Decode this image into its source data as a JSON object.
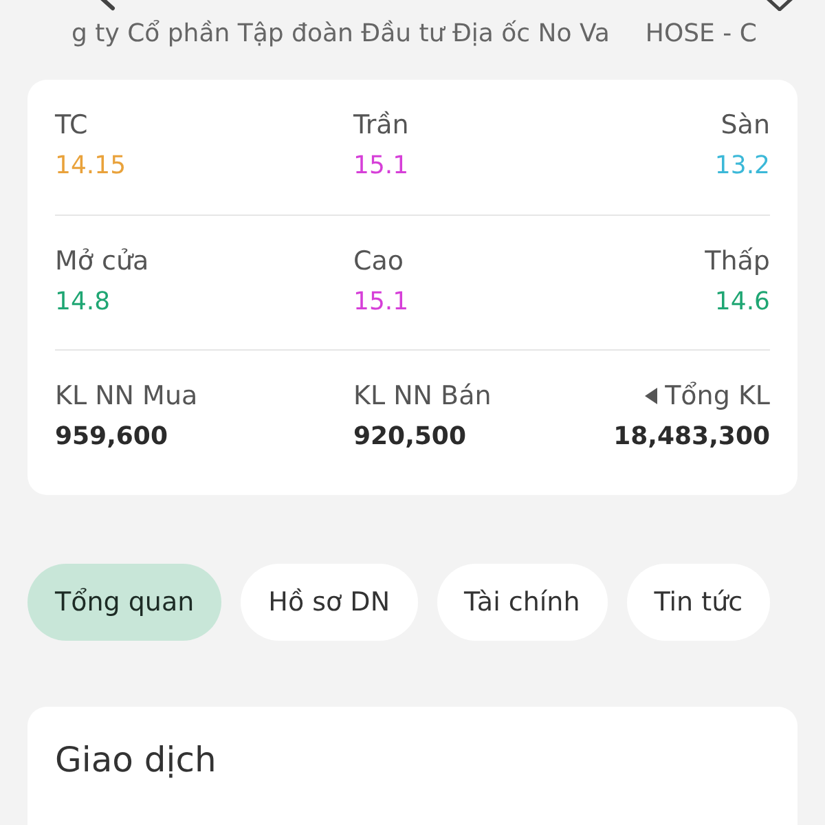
{
  "header": {
    "subtitle": "g ty Cổ phần Tập đoàn Đầu tư Địa ốc No Va",
    "exchange": "HOSE - C"
  },
  "stats": [
    [
      {
        "label": "TC",
        "value": "14.15",
        "color": "#e9a23b"
      },
      {
        "label": "Trần",
        "value": "15.1",
        "color": "#d63fd8"
      },
      {
        "label": "Sàn",
        "value": "13.2",
        "color": "#3bb8d8"
      }
    ],
    [
      {
        "label": "Mở cửa",
        "value": "14.8",
        "color": "#1fa673"
      },
      {
        "label": "Cao",
        "value": "15.1",
        "color": "#d63fd8"
      },
      {
        "label": "Thấp",
        "value": "14.6",
        "color": "#1fa673"
      }
    ],
    [
      {
        "label": "KL NN Mua",
        "value": "959,600",
        "color": "#2b2b2b"
      },
      {
        "label": "KL NN Bán",
        "value": "920,500",
        "color": "#2b2b2b"
      },
      {
        "label": "Tổng KL",
        "value": "18,483,300",
        "color": "#2b2b2b",
        "expandable": true
      }
    ]
  ],
  "tabs": [
    {
      "label": "Tổng quan",
      "selected": true
    },
    {
      "label": "Hồ sơ DN",
      "selected": false
    },
    {
      "label": "Tài chính",
      "selected": false
    },
    {
      "label": "Tin tức",
      "selected": false
    }
  ],
  "section": {
    "title": "Giao dịch"
  }
}
